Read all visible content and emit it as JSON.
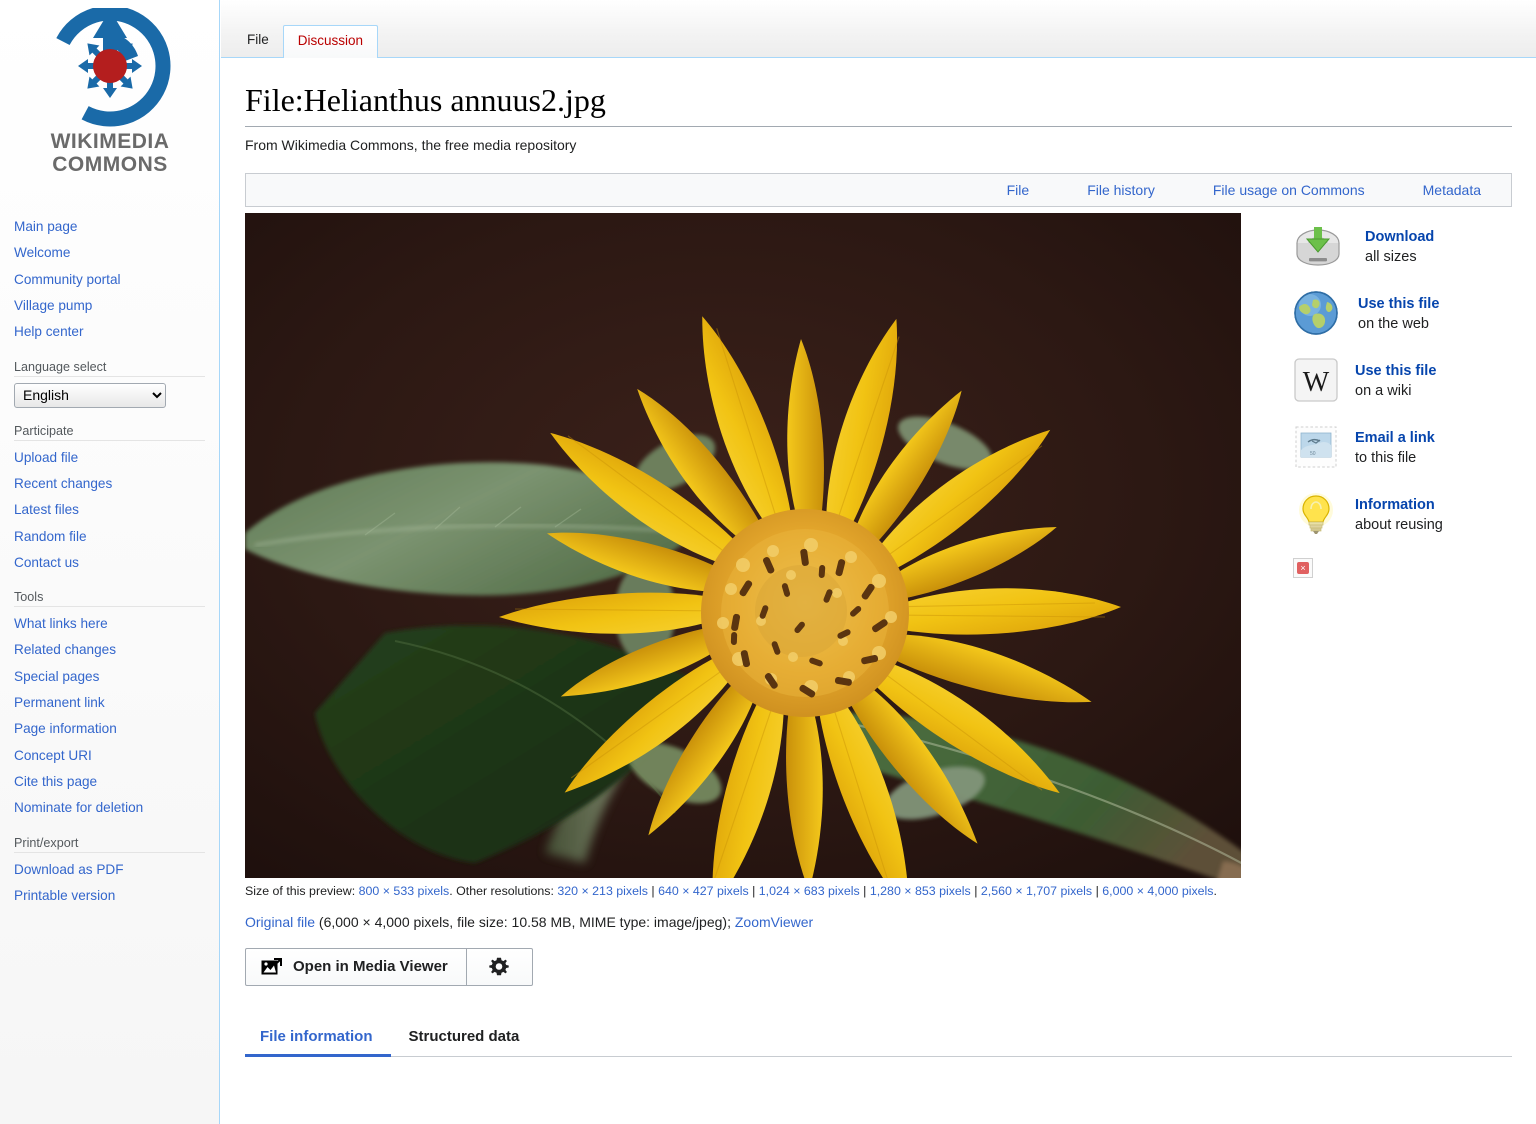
{
  "sidebar": {
    "logo_line1": "WIKIMEDIA",
    "logo_line2": "COMMONS",
    "nav_top": [
      {
        "label": "Main page"
      },
      {
        "label": "Welcome"
      },
      {
        "label": "Community portal"
      },
      {
        "label": "Village pump"
      },
      {
        "label": "Help center"
      }
    ],
    "language_heading": "Language select",
    "language_selected": "English",
    "language_options": [
      "English"
    ],
    "participate_heading": "Participate",
    "participate": [
      {
        "label": "Upload file"
      },
      {
        "label": "Recent changes"
      },
      {
        "label": "Latest files"
      },
      {
        "label": "Random file"
      },
      {
        "label": "Contact us"
      }
    ],
    "tools_heading": "Tools",
    "tools": [
      {
        "label": "What links here"
      },
      {
        "label": "Related changes"
      },
      {
        "label": "Special pages"
      },
      {
        "label": "Permanent link"
      },
      {
        "label": "Page information"
      },
      {
        "label": "Concept URI"
      },
      {
        "label": "Cite this page"
      },
      {
        "label": "Nominate for deletion"
      }
    ],
    "print_heading": "Print/export",
    "print": [
      {
        "label": "Download as PDF"
      },
      {
        "label": "Printable version"
      }
    ]
  },
  "tabs": {
    "file": "File",
    "discussion": "Discussion"
  },
  "page": {
    "title": "File:Helianthus annuus2.jpg",
    "subtitle": "From Wikimedia Commons, the free media repository"
  },
  "filenav": [
    {
      "label": "File"
    },
    {
      "label": "File history"
    },
    {
      "label": "File usage on Commons"
    },
    {
      "label": "Metadata"
    }
  ],
  "actions": [
    {
      "title": "Download",
      "subtitle": "all sizes",
      "icon": "hard-drive-download-icon"
    },
    {
      "title": "Use this file",
      "subtitle": "on the web",
      "icon": "globe-icon"
    },
    {
      "title": "Use this file",
      "subtitle": "on a wiki",
      "icon": "wikipedia-w-icon"
    },
    {
      "title": "Email a link",
      "subtitle": "to this file",
      "icon": "postage-stamp-icon"
    },
    {
      "title": "Information",
      "subtitle": "about reusing",
      "icon": "lightbulb-icon"
    }
  ],
  "preview": {
    "size_prefix": "Size of this preview:",
    "current_size": "800 × 533 pixels",
    "other_prefix": ". Other resolutions:",
    "resolutions": [
      "320 × 213 pixels",
      "640 × 427 pixels",
      "1,024 × 683 pixels",
      "1,280 × 853 pixels",
      "2,560 × 1,707 pixels",
      "6,000 × 4,000 pixels"
    ],
    "separator": " | ",
    "trailing_period": ".",
    "original_link": "Original file",
    "original_detail": " (6,000 × 4,000 pixels, file size: 10.58 MB, MIME type: image/jpeg); ",
    "zoomviewer": "ZoomViewer"
  },
  "mediaviewer": {
    "open_label": "Open in Media Viewer",
    "gear_label": "⚙"
  },
  "bottom_tabs": [
    {
      "label": "File information",
      "active": true
    },
    {
      "label": "Structured data",
      "active": false
    }
  ],
  "image": {
    "alt": "Close-up photograph of a sunflower (Helianthus annuus) with yellow ray petals and an orange disc, green leaves, dark brown background",
    "colors": {
      "background_dark": "#2b1713",
      "petal_yellow": "#f1c313",
      "petal_yellow_deep": "#e0a50c",
      "disc_orange": "#e8a52a",
      "anther_brown": "#5a3410",
      "leaf_green": "#6f8a63",
      "leaf_dark_green": "#2f4a22"
    }
  },
  "theme": {
    "link_blue": "#3366cc",
    "link_blue_bold": "#0645ad",
    "newpage_red": "#ba0000",
    "border_blue": "#a7d7f9",
    "heading_gray": "#54595d",
    "logo_blue": "#1a6aa8",
    "logo_red": "#b41e1e"
  }
}
